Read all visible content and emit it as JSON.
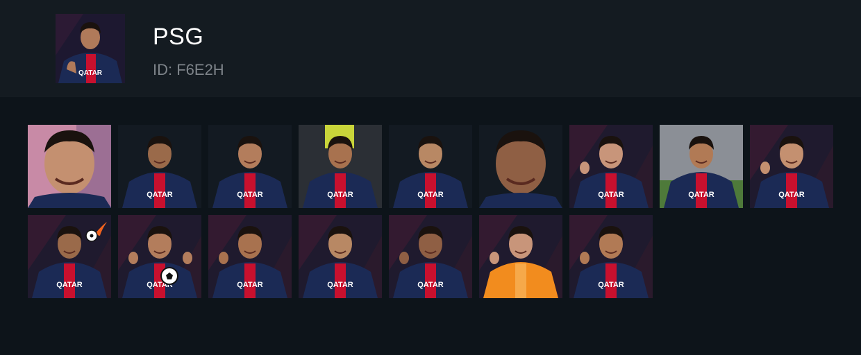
{
  "pack": {
    "title": "PSG",
    "id_text": "ID: F6E2H",
    "thumb_icon": "player-sticker-icon"
  },
  "colors": {
    "page_bg": "#0d141a",
    "header_bg": "#141b21",
    "psg_navy": "#1b2a55",
    "psg_red": "#c8102e",
    "keeper_orange": "#f28c1e"
  },
  "stickers": [
    {
      "icon": "player-smiling-sticker-icon",
      "bg": "pink",
      "kit": "navy",
      "row": 0,
      "col": 0
    },
    {
      "icon": "player-side-glance-sticker-icon",
      "bg": "dark",
      "kit": "navy",
      "row": 0,
      "col": 1
    },
    {
      "icon": "player-turning-head-sticker-icon",
      "bg": "dark",
      "kit": "navy",
      "row": 0,
      "col": 2
    },
    {
      "icon": "player-laughing-sticker-icon",
      "bg": "yellow",
      "kit": "navy",
      "row": 0,
      "col": 3
    },
    {
      "icon": "player-puzzled-sticker-icon",
      "bg": "dark",
      "kit": "navy",
      "row": 0,
      "col": 4
    },
    {
      "icon": "player-close-up-sticker-icon",
      "bg": "dark",
      "kit": "red",
      "row": 0,
      "col": 5
    },
    {
      "icon": "player-hands-on-face-sticker-icon",
      "bg": "maroon",
      "kit": "navy",
      "row": 0,
      "col": 6
    },
    {
      "icon": "player-celebration-sticker-icon",
      "bg": "pitch",
      "kit": "navy",
      "row": 0,
      "col": 7
    },
    {
      "icon": "player-blowing-kiss-sticker-icon",
      "bg": "maroon",
      "kit": "navy",
      "row": 0,
      "col": 8
    },
    {
      "icon": "player-fireball-sticker-icon",
      "bg": "maroon",
      "kit": "navy",
      "row": 1,
      "col": 0
    },
    {
      "icon": "player-thumbs-up-ball-sticker-icon",
      "bg": "maroon",
      "kit": "navy",
      "row": 1,
      "col": 1
    },
    {
      "icon": "player-fist-pump-sticker-icon",
      "bg": "maroon",
      "kit": "navy",
      "row": 1,
      "col": 2
    },
    {
      "icon": "player-grinning-sticker-icon",
      "bg": "maroon",
      "kit": "navy",
      "row": 1,
      "col": 3
    },
    {
      "icon": "player-cheering-fist-sticker-icon",
      "bg": "maroon",
      "kit": "navy",
      "row": 1,
      "col": 4
    },
    {
      "icon": "goalkeeper-pointing-up-sticker-icon",
      "bg": "maroon",
      "kit": "orange",
      "row": 1,
      "col": 5
    },
    {
      "icon": "player-crossed-arms-sticker-icon",
      "bg": "maroon",
      "kit": "navy",
      "row": 1,
      "col": 6
    }
  ]
}
